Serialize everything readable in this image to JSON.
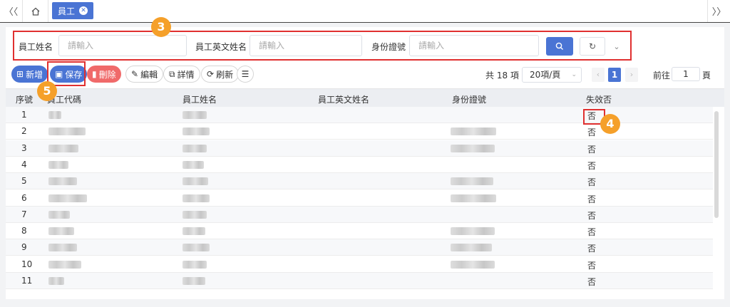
{
  "topbar": {
    "nav_left": "〈〈",
    "nav_right": "〉〉",
    "active_tab": "員工"
  },
  "search": {
    "name_label": "員工姓名",
    "name_placeholder": "請輸入",
    "en_name_label": "員工英文姓名",
    "en_name_placeholder": "請輸入",
    "id_label": "身份證號",
    "id_placeholder": "請輸入"
  },
  "toolbar": {
    "add": "新增",
    "save": "保存",
    "delete": "刪除",
    "edit": "編輯",
    "detail": "詳情",
    "refresh": "刷新"
  },
  "pager": {
    "total": "共 18 項",
    "page_size": "20項/頁",
    "current_page": "1",
    "goto_prefix": "前往",
    "goto_value": "1",
    "goto_suffix": "頁"
  },
  "table": {
    "headers": {
      "seq": "序號",
      "code": "員工代碼",
      "name": "員工姓名",
      "en_name": "員工英文姓名",
      "id_no": "身份證號",
      "inactive": "失效否"
    },
    "rows": [
      {
        "seq": "1",
        "inactive": "否"
      },
      {
        "seq": "2",
        "inactive": "否"
      },
      {
        "seq": "3",
        "inactive": "否"
      },
      {
        "seq": "4",
        "inactive": "否"
      },
      {
        "seq": "5",
        "inactive": "否"
      },
      {
        "seq": "6",
        "inactive": "否"
      },
      {
        "seq": "7",
        "inactive": "否"
      },
      {
        "seq": "8",
        "inactive": "否"
      },
      {
        "seq": "9",
        "inactive": "否"
      },
      {
        "seq": "10",
        "inactive": "否"
      },
      {
        "seq": "11",
        "inactive": "否"
      }
    ]
  },
  "annotations": {
    "badge_3": "3",
    "badge_4": "4",
    "badge_5": "5"
  },
  "colors": {
    "primary": "#4a74d4",
    "danger": "#f06a6a",
    "highlight": "#e03030",
    "badge": "#f5a02a"
  }
}
